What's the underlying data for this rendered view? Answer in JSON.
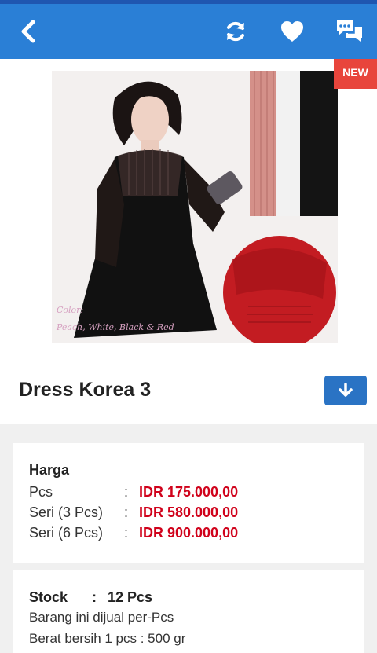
{
  "appbar": {
    "back_icon": "chevron-left-icon",
    "refresh_icon": "refresh-icon",
    "favorite_icon": "heart-icon",
    "chat_icon": "chat-bubbles-icon",
    "color": "#2a7fd6"
  },
  "product": {
    "badge": "NEW",
    "image_caption": "Color: Peach, White, Black & Red",
    "title": "Dress Korea 3"
  },
  "price": {
    "heading": "Harga",
    "rows": [
      {
        "label": "Pcs",
        "value": "IDR 175.000,00"
      },
      {
        "label": "Seri (3 Pcs)",
        "value": "IDR 580.000,00"
      },
      {
        "label": "Seri (6 Pcs)",
        "value": "IDR 900.000,00"
      }
    ]
  },
  "stock": {
    "label": "Stock",
    "value": "12 Pcs",
    "note": "Barang ini dijual per-Pcs",
    "weight": "Berat bersih 1 pcs : 500 gr"
  }
}
